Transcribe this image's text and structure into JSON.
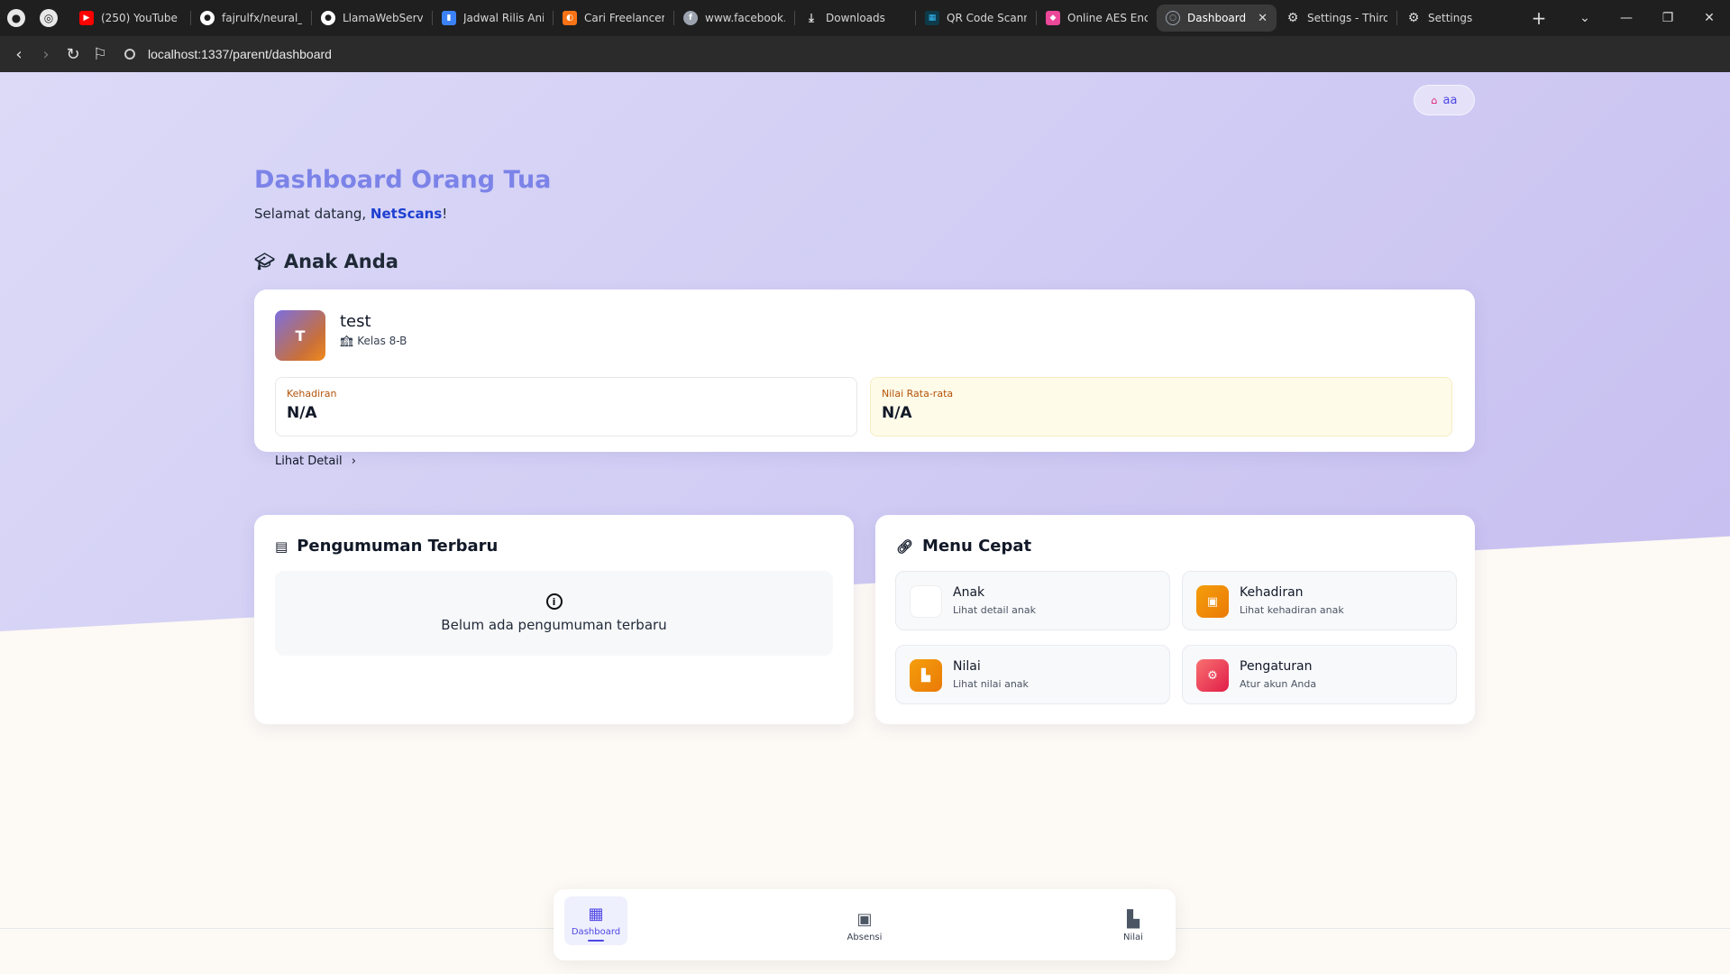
{
  "browser": {
    "tabs": [
      {
        "label": "(250) YouTube",
        "icon": "youtube-icon",
        "color": "#ff0000"
      },
      {
        "label": "fajrulfx/neural_n",
        "icon": "github-icon",
        "color": "#ffffff"
      },
      {
        "label": "LlamaWebServe",
        "icon": "github-icon",
        "color": "#ffffff"
      },
      {
        "label": "Jadwal Rilis Anin",
        "icon": "bookmark-icon",
        "color": "#3b82f6"
      },
      {
        "label": "Cari Freelancer I",
        "icon": "freelancer-icon",
        "color": "#f97316"
      },
      {
        "label": "www.facebook.c",
        "icon": "facebook-icon",
        "color": "#9ca3af"
      },
      {
        "label": "Downloads",
        "icon": "download-icon",
        "color": "#dddddd"
      },
      {
        "label": "QR Code Scann",
        "icon": "qr-icon",
        "color": "#38bdf8"
      },
      {
        "label": "Online AES Enc",
        "icon": "aes-icon",
        "color": "#ec4899"
      },
      {
        "label": "Dashboard",
        "icon": "dashboard-tab-icon",
        "color": "#9ca3af"
      },
      {
        "label": "Settings - Third",
        "icon": "gear-icon",
        "color": "#dddddd"
      },
      {
        "label": "Settings",
        "icon": "gear-icon",
        "color": "#dddddd"
      }
    ],
    "active_tab": 9,
    "url": "localhost:1337/parent/dashboard"
  },
  "header": {
    "user_label": "aa",
    "title": "Dashboard Orang Tua",
    "welcome_prefix": "Selamat datang, ",
    "welcome_name": "NetScans",
    "welcome_suffix": "!"
  },
  "children_section": {
    "title": "Anak Anda",
    "child": {
      "initial": "T",
      "name": "test",
      "class": "Kelas 8-B",
      "attendance_label": "Kehadiran",
      "attendance_value": "N/A",
      "avg_label": "Nilai Rata-rata",
      "avg_value": "N/A",
      "detail_link": "Lihat Detail"
    }
  },
  "announcements": {
    "title": "Pengumuman Terbaru",
    "empty_message": "Belum ada pengumuman terbaru"
  },
  "quick_menu": {
    "title": "Menu Cepat",
    "items": [
      {
        "title": "Anak",
        "subtitle": "Lihat detail anak"
      },
      {
        "title": "Kehadiran",
        "subtitle": "Lihat kehadiran anak"
      },
      {
        "title": "Nilai",
        "subtitle": "Lihat nilai anak"
      },
      {
        "title": "Pengaturan",
        "subtitle": "Atur akun Anda"
      }
    ]
  },
  "bottom_nav": {
    "items": [
      {
        "label": "Dashboard",
        "active": true
      },
      {
        "label": "Absensi",
        "active": false
      },
      {
        "label": "Nilai",
        "active": false
      }
    ]
  }
}
